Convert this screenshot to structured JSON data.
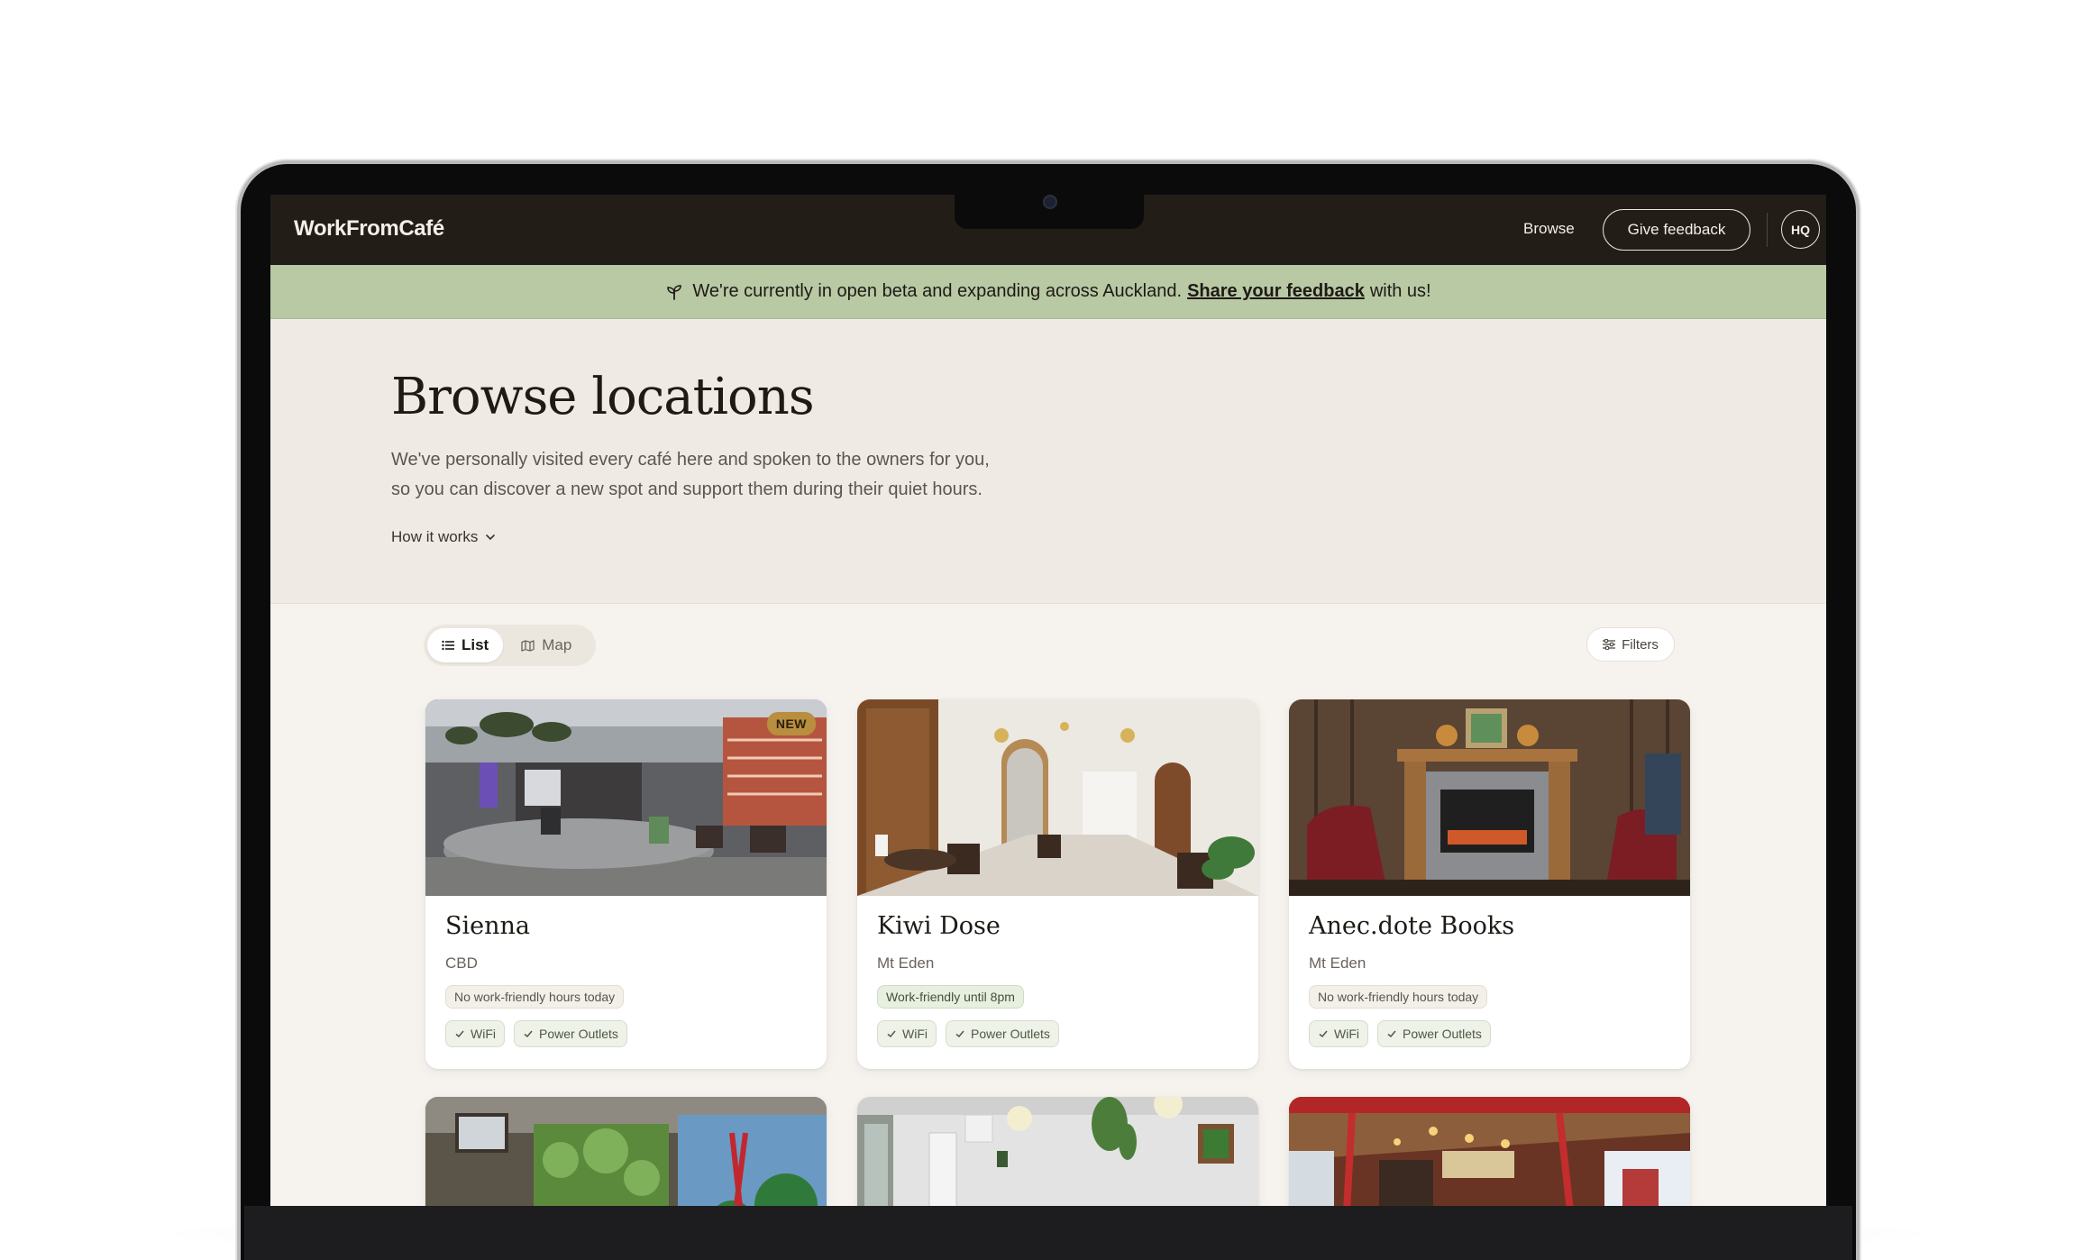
{
  "nav": {
    "logo": "WorkFromCafé",
    "browse_label": "Browse",
    "feedback_label": "Give feedback",
    "avatar_initials": "HQ"
  },
  "banner": {
    "text_before": "We're currently in open beta and expanding across Auckland.",
    "link_text": "Share your feedback",
    "text_after": "with us!",
    "icon": "sprout-icon"
  },
  "hero": {
    "title": "Browse locations",
    "description_line1": "We've personally visited every café here and spoken to the owners for you,",
    "description_line2": "so you can discover a new spot and support them during their quiet hours.",
    "how_it_works": "How it works"
  },
  "view_toggle": {
    "list_label": "List",
    "map_label": "Map",
    "active": "List"
  },
  "filters_label": "Filters",
  "cards": [
    {
      "name": "Sienna",
      "area": "CBD",
      "badge": "NEW",
      "hours": "No work-friendly hours today",
      "hours_status": "none",
      "tags": [
        "WiFi",
        "Power Outlets"
      ]
    },
    {
      "name": "Kiwi Dose",
      "area": "Mt Eden",
      "badge": "",
      "hours": "Work-friendly until 8pm",
      "hours_status": "open",
      "tags": [
        "WiFi",
        "Power Outlets"
      ]
    },
    {
      "name": "Anec.dote Books",
      "area": "Mt Eden",
      "badge": "",
      "hours": "No work-friendly hours today",
      "hours_status": "none",
      "tags": [
        "WiFi",
        "Power Outlets"
      ]
    }
  ],
  "colors": {
    "nav_bg": "#231d17",
    "banner_bg": "#b8c9a4",
    "hero_bg": "#efebe4",
    "page_bg": "#f6f3ee",
    "badge_new": "#b98e3e"
  }
}
